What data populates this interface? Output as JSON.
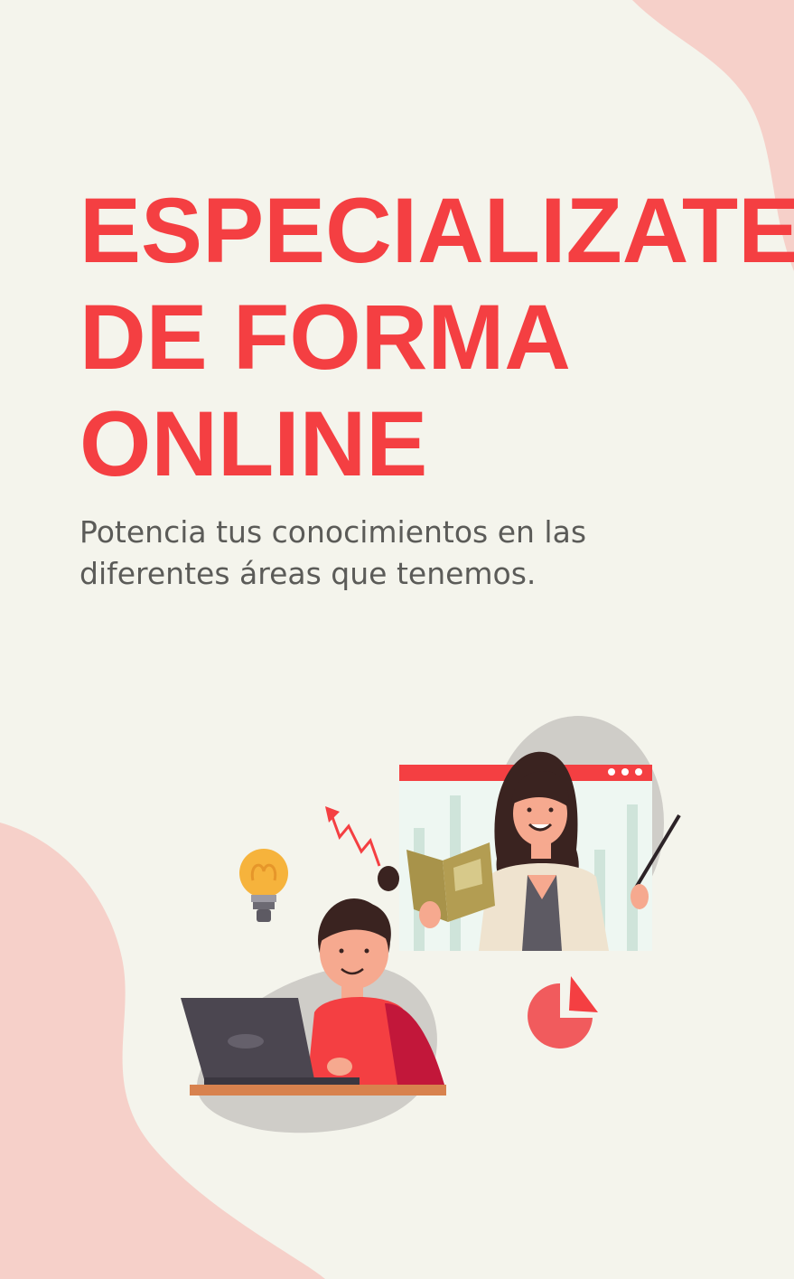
{
  "headline": {
    "line1": "ESPECIALIZATE",
    "line2": "DE FORMA",
    "line3": "ONLINE"
  },
  "subtitle": {
    "line1": "Potencia tus conocimientos en las",
    "line2": "diferentes áreas que tenemos."
  },
  "colors": {
    "background": "#f4f4ec",
    "accent_red": "#f43f42",
    "blob_pink": "#f6d0c9",
    "text_gray": "#5b5b58"
  },
  "illustration": {
    "icons": [
      "lightbulb-icon",
      "trend-arrow-icon",
      "pie-chart-icon",
      "laptop-icon"
    ]
  }
}
